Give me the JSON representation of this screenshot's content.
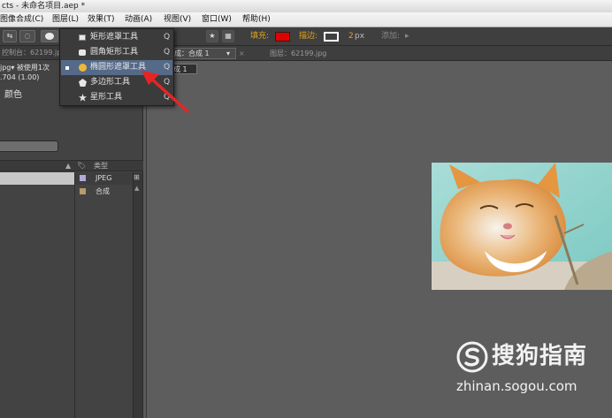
{
  "title_bar": {
    "text": "cts - 未命名项目.aep *"
  },
  "menu": {
    "items": [
      "图像合成(C)",
      "图层(L)",
      "效果(T)",
      "动画(A)",
      "视图(V)",
      "窗口(W)",
      "帮助(H)"
    ]
  },
  "toolbar": {
    "fill_label": "填充:",
    "stroke_label": "描边:",
    "stroke_width": "2",
    "stroke_unit": "px",
    "add_label": "添加:",
    "fill_color": "#e00000",
    "stroke_color": "#ffffff"
  },
  "shape_menu": {
    "items": [
      {
        "label": "矩形遮罩工具",
        "shortcut": "Q",
        "icon": "rectangle-icon",
        "checked": false
      },
      {
        "label": "圆角矩形工具",
        "shortcut": "Q",
        "icon": "rounded-rectangle-icon",
        "checked": false
      },
      {
        "label": "椭圆形遮罩工具",
        "shortcut": "Q",
        "icon": "ellipse-icon",
        "checked": true
      },
      {
        "label": "多边形工具",
        "shortcut": "Q",
        "icon": "polygon-icon",
        "checked": false
      },
      {
        "label": "星形工具",
        "shortcut": "Q",
        "icon": "star-icon",
        "checked": false
      }
    ]
  },
  "project_panel": {
    "tab_label": "控制台：62199.jpg",
    "file_info": "jpg▾  被使用1次",
    "file_dims": ".704 (1.00)",
    "color_label": "颜色",
    "column_type": "类型",
    "items": [
      {
        "type": "JPEG",
        "color": "#b3a7d8"
      },
      {
        "type": "合成",
        "color": "#b79a6e"
      }
    ]
  },
  "viewer_tabs": {
    "comp_label": "合成：合成 1",
    "layer_label": "图层：62199.jpg",
    "breadcrumb": "成 1"
  },
  "watermark": {
    "brand": "搜狗指南",
    "url": "zhinan.sogou.com"
  }
}
